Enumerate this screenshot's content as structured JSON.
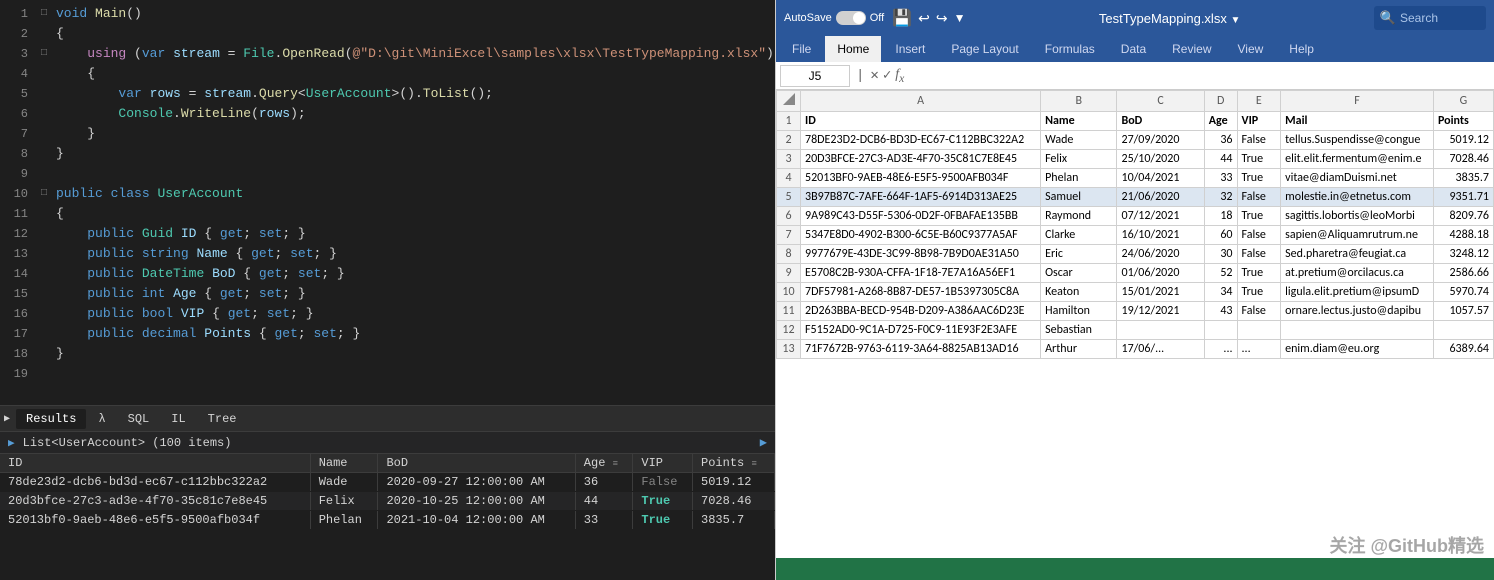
{
  "editor": {
    "lines": [
      {
        "num": 1,
        "collapse": "□",
        "content": "void Main()",
        "type": "code"
      },
      {
        "num": 2,
        "collapse": "",
        "content": "{",
        "type": "code"
      },
      {
        "num": 3,
        "collapse": "□",
        "content": "    using (var stream = File.OpenRead(@\"D:\\git\\MiniExcel\\samples\\xlsx\\TestTypeMapping.xlsx\"))",
        "type": "code"
      },
      {
        "num": 4,
        "collapse": "",
        "content": "    {",
        "type": "code"
      },
      {
        "num": 5,
        "collapse": "",
        "content": "        var rows = stream.Query<UserAccount>().ToList();",
        "type": "code"
      },
      {
        "num": 6,
        "collapse": "",
        "content": "        Console.WriteLine(rows);",
        "type": "code"
      },
      {
        "num": 7,
        "collapse": "",
        "content": "    }",
        "type": "code"
      },
      {
        "num": 8,
        "collapse": "",
        "content": "}",
        "type": "code"
      },
      {
        "num": 9,
        "collapse": "",
        "content": "",
        "type": "code"
      },
      {
        "num": 10,
        "collapse": "□",
        "content": "public class UserAccount",
        "type": "code"
      },
      {
        "num": 11,
        "collapse": "",
        "content": "{",
        "type": "code"
      },
      {
        "num": 12,
        "collapse": "",
        "content": "    public Guid ID { get; set; }",
        "type": "code"
      },
      {
        "num": 13,
        "collapse": "",
        "content": "    public string Name { get; set; }",
        "type": "code"
      },
      {
        "num": 14,
        "collapse": "",
        "content": "    public DateTime BoD { get; set; }",
        "type": "code"
      },
      {
        "num": 15,
        "collapse": "",
        "content": "    public int Age { get; set; }",
        "type": "code"
      },
      {
        "num": 16,
        "collapse": "",
        "content": "    public bool VIP { get; set; }",
        "type": "code"
      },
      {
        "num": 17,
        "collapse": "",
        "content": "    public decimal Points { get; set; }",
        "type": "code"
      },
      {
        "num": 18,
        "collapse": "",
        "content": "}",
        "type": "code"
      },
      {
        "num": 19,
        "collapse": "",
        "content": "",
        "type": "code"
      }
    ]
  },
  "bottom_tabs": {
    "tabs": [
      "Results",
      "λ",
      "SQL",
      "IL",
      "Tree"
    ],
    "active": "Results"
  },
  "list_header": {
    "title": "List<UserAccount> (100 items)",
    "arrow": "▶"
  },
  "table_columns": [
    "ID",
    "Name",
    "BoD",
    "Age",
    "VIP",
    "Points"
  ],
  "table_rows": [
    {
      "id": "78de23d2-dcb6-bd3d-ec67-c112bbc322a2",
      "name": "Wade",
      "bod": "2020-09-27 12:00:00 AM",
      "age": "36",
      "vip": "False",
      "points": "5019.12"
    },
    {
      "id": "20d3bfce-27c3-ad3e-4f70-35c81c7e8e45",
      "name": "Felix",
      "bod": "2020-10-25 12:00:00 AM",
      "age": "44",
      "vip": "True",
      "points": "7028.46"
    },
    {
      "id": "52013bf0-9aeb-48e6-e5f5-9500afb034f",
      "name": "Phelan",
      "bod": "2021-10-04 12:00:00 AM",
      "age": "33",
      "vip": "True",
      "points": "3835.7"
    }
  ],
  "excel": {
    "titlebar": {
      "autosave_label": "AutoSave",
      "off_label": "Off",
      "filename": "TestTypeMapping.xlsx",
      "search_placeholder": "Search"
    },
    "ribbon_tabs": [
      "File",
      "Home",
      "Insert",
      "Page Layout",
      "Formulas",
      "Data",
      "Review",
      "View",
      "Help"
    ],
    "active_tab": "Home",
    "cell_ref": "J5",
    "sheet_columns": [
      "A",
      "B",
      "C",
      "D",
      "E",
      "F",
      "G"
    ],
    "sheet_headers": [
      "ID",
      "Name",
      "BoD",
      "Age",
      "VIP",
      "Mail",
      "Points"
    ],
    "sheet_rows": [
      {
        "row": 2,
        "id": "78DE23D2-DCB6-BD3D-EC67-C112BBC322A2",
        "name": "Wade",
        "bod": "27/09/2020",
        "age": "36",
        "vip": "False",
        "mail": "tellus.Suspendisse@congue",
        "points": "5019.12"
      },
      {
        "row": 3,
        "id": "20D3BFCE-27C3-AD3E-4F70-35C81C7E8E45",
        "name": "Felix",
        "bod": "25/10/2020",
        "age": "44",
        "vip": "True",
        "mail": "elit.elit.fermentum@enim.e",
        "points": "7028.46"
      },
      {
        "row": 4,
        "id": "52013BF0-9AEB-48E6-E5F5-9500AFB034F",
        "name": "Phelan",
        "bod": "10/04/2021",
        "age": "33",
        "vip": "True",
        "mail": "vitae@diamDuismi.net",
        "points": "3835.7"
      },
      {
        "row": 5,
        "id": "3B97B87C-7AFE-664F-1AF5-6914D313AE25",
        "name": "Samuel",
        "bod": "21/06/2020",
        "age": "32",
        "vip": "False",
        "mail": "molestie.in@etnetus.com",
        "points": "9351.71",
        "selected": true
      },
      {
        "row": 6,
        "id": "9A989C43-D55F-5306-0D2F-0FBAFAE135BB",
        "name": "Raymond",
        "bod": "07/12/2021",
        "age": "18",
        "vip": "True",
        "mail": "sagittis.lobortis@leoMorbi",
        "points": "8209.76"
      },
      {
        "row": 7,
        "id": "5347E8D0-4902-B300-6C5E-B60C9377A5AF",
        "name": "Clarke",
        "bod": "16/10/2021",
        "age": "60",
        "vip": "False",
        "mail": "sapien@Aliquamrutrum.ne",
        "points": "4288.18"
      },
      {
        "row": 8,
        "id": "9977679E-43DE-3C99-8B98-7B9D0AE31A50",
        "name": "Eric",
        "bod": "24/06/2020",
        "age": "30",
        "vip": "False",
        "mail": "Sed.pharetra@feugiat.ca",
        "points": "3248.12"
      },
      {
        "row": 9,
        "id": "E5708C2B-930A-CFFA-1F18-7E7A16A56EF1",
        "name": "Oscar",
        "bod": "01/06/2020",
        "age": "52",
        "vip": "True",
        "mail": "at.pretium@orcilacus.ca",
        "points": "2586.66"
      },
      {
        "row": 10,
        "id": "7DF57981-A268-8B87-DE57-1B5397305C8A",
        "name": "Keaton",
        "bod": "15/01/2021",
        "age": "34",
        "vip": "True",
        "mail": "ligula.elit.pretium@ipsumD",
        "points": "5970.74"
      },
      {
        "row": 11,
        "id": "2D263BBA-BECD-954B-D209-A386AAC6D23E",
        "name": "Hamilton",
        "bod": "19/12/2021",
        "age": "43",
        "vip": "False",
        "mail": "ornare.lectus.justo@dapibu",
        "points": "1057.57"
      },
      {
        "row": 12,
        "id": "F5152AD0-9C1A-D725-F0C9-11E93F2E3AFE",
        "name": "Sebastian",
        "bod": "",
        "age": "",
        "vip": "",
        "mail": "",
        "points": ""
      },
      {
        "row": 13,
        "id": "71F7672B-9763-6119-3A64-8825AB13AD16",
        "name": "Arthur",
        "bod": "17/06/...",
        "age": "...",
        "vip": "...",
        "mail": "enim.diam@eu.org",
        "points": "6389.64"
      }
    ],
    "statusbar": ""
  },
  "watermark": "关注 @GitHub精选"
}
